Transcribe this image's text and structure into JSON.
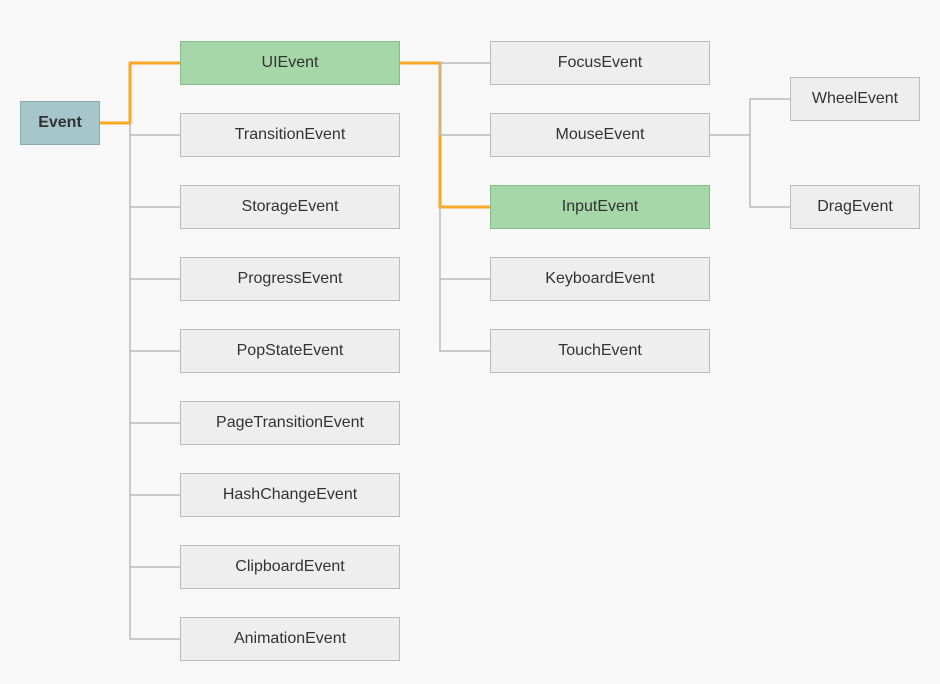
{
  "diagram": {
    "root": {
      "label": "Event"
    },
    "col1": {
      "ui": {
        "label": "UIEvent",
        "highlight": true
      },
      "transition": {
        "label": "TransitionEvent"
      },
      "storage": {
        "label": "StorageEvent"
      },
      "progress": {
        "label": "ProgressEvent"
      },
      "popstate": {
        "label": "PopStateEvent"
      },
      "pagetrans": {
        "label": "PageTransitionEvent"
      },
      "hashchange": {
        "label": "HashChangeEvent"
      },
      "clipboard": {
        "label": "ClipboardEvent"
      },
      "animation": {
        "label": "AnimationEvent"
      }
    },
    "col2": {
      "focus": {
        "label": "FocusEvent"
      },
      "mouse": {
        "label": "MouseEvent"
      },
      "input": {
        "label": "InputEvent",
        "highlight": true
      },
      "keyboard": {
        "label": "KeyboardEvent"
      },
      "touch": {
        "label": "TouchEvent"
      }
    },
    "col3": {
      "wheel": {
        "label": "WheelEvent"
      },
      "drag": {
        "label": "DragEvent"
      }
    }
  },
  "colors": {
    "highlight_fill": "#a6d7a8",
    "root_fill": "#a6c6cb",
    "normal_fill": "#eeeeee",
    "connector": "#bbb",
    "highlight_connector": "#f9a825"
  }
}
